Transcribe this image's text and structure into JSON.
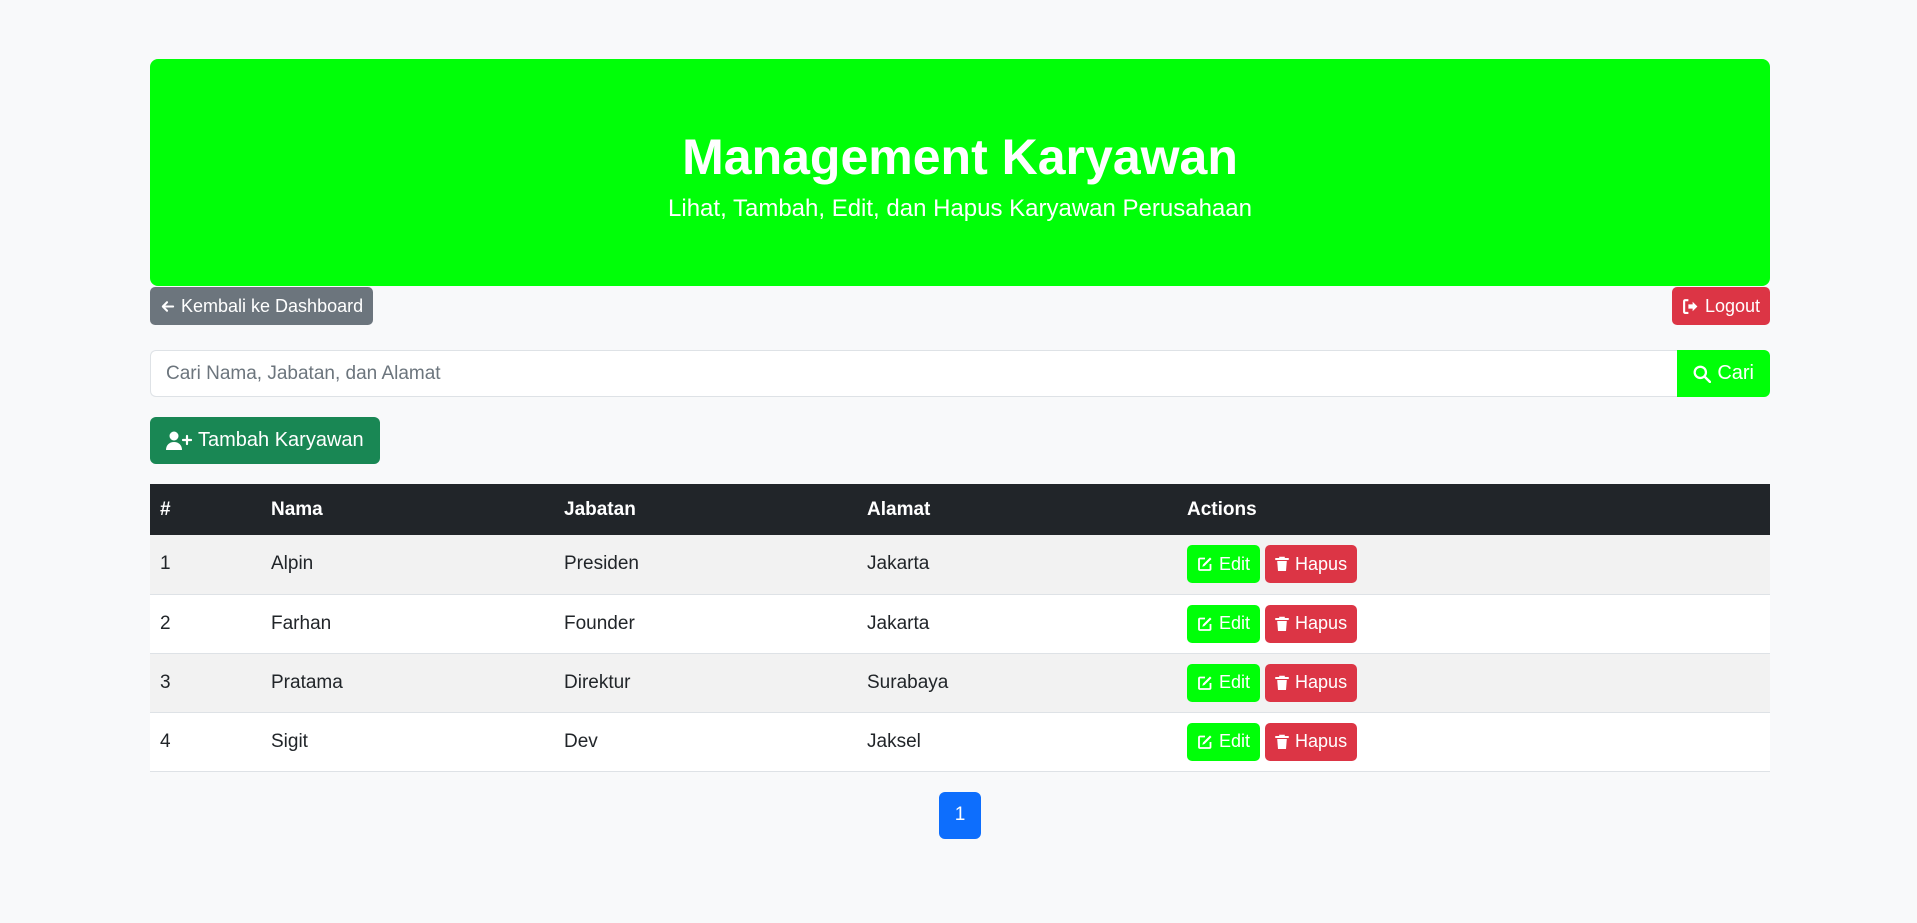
{
  "header": {
    "title": "Management Karyawan",
    "subtitle": "Lihat, Tambah, Edit, dan Hapus Karyawan Perusahaan"
  },
  "nav": {
    "back_label": "Kembali ke Dashboard",
    "logout_label": "Logout"
  },
  "search": {
    "placeholder": "Cari Nama, Jabatan, dan Alamat",
    "value": "",
    "button_label": "Cari"
  },
  "add_button_label": "Tambah Karyawan",
  "table": {
    "headers": [
      "#",
      "Nama",
      "Jabatan",
      "Alamat",
      "Actions"
    ],
    "rows": [
      {
        "num": "1",
        "nama": "Alpin",
        "jabatan": "Presiden",
        "alamat": "Jakarta"
      },
      {
        "num": "2",
        "nama": "Farhan",
        "jabatan": "Founder",
        "alamat": "Jakarta"
      },
      {
        "num": "3",
        "nama": "Pratama",
        "jabatan": "Direktur",
        "alamat": "Surabaya"
      },
      {
        "num": "4",
        "nama": "Sigit",
        "jabatan": "Dev",
        "alamat": "Jaksel"
      }
    ],
    "edit_label": "Edit",
    "delete_label": "Hapus"
  },
  "pagination": {
    "current_page": "1"
  },
  "colors": {
    "header_bg": "#00ff08",
    "back": "#6c757d",
    "danger": "#dc3545",
    "success": "#198754",
    "primary": "#0d6efd",
    "table_header": "#212529"
  },
  "icons": {
    "back": "arrow-left-icon",
    "logout": "logout-icon",
    "search": "search-icon",
    "add": "user-plus-icon",
    "edit": "edit-icon",
    "delete": "trash-icon"
  }
}
